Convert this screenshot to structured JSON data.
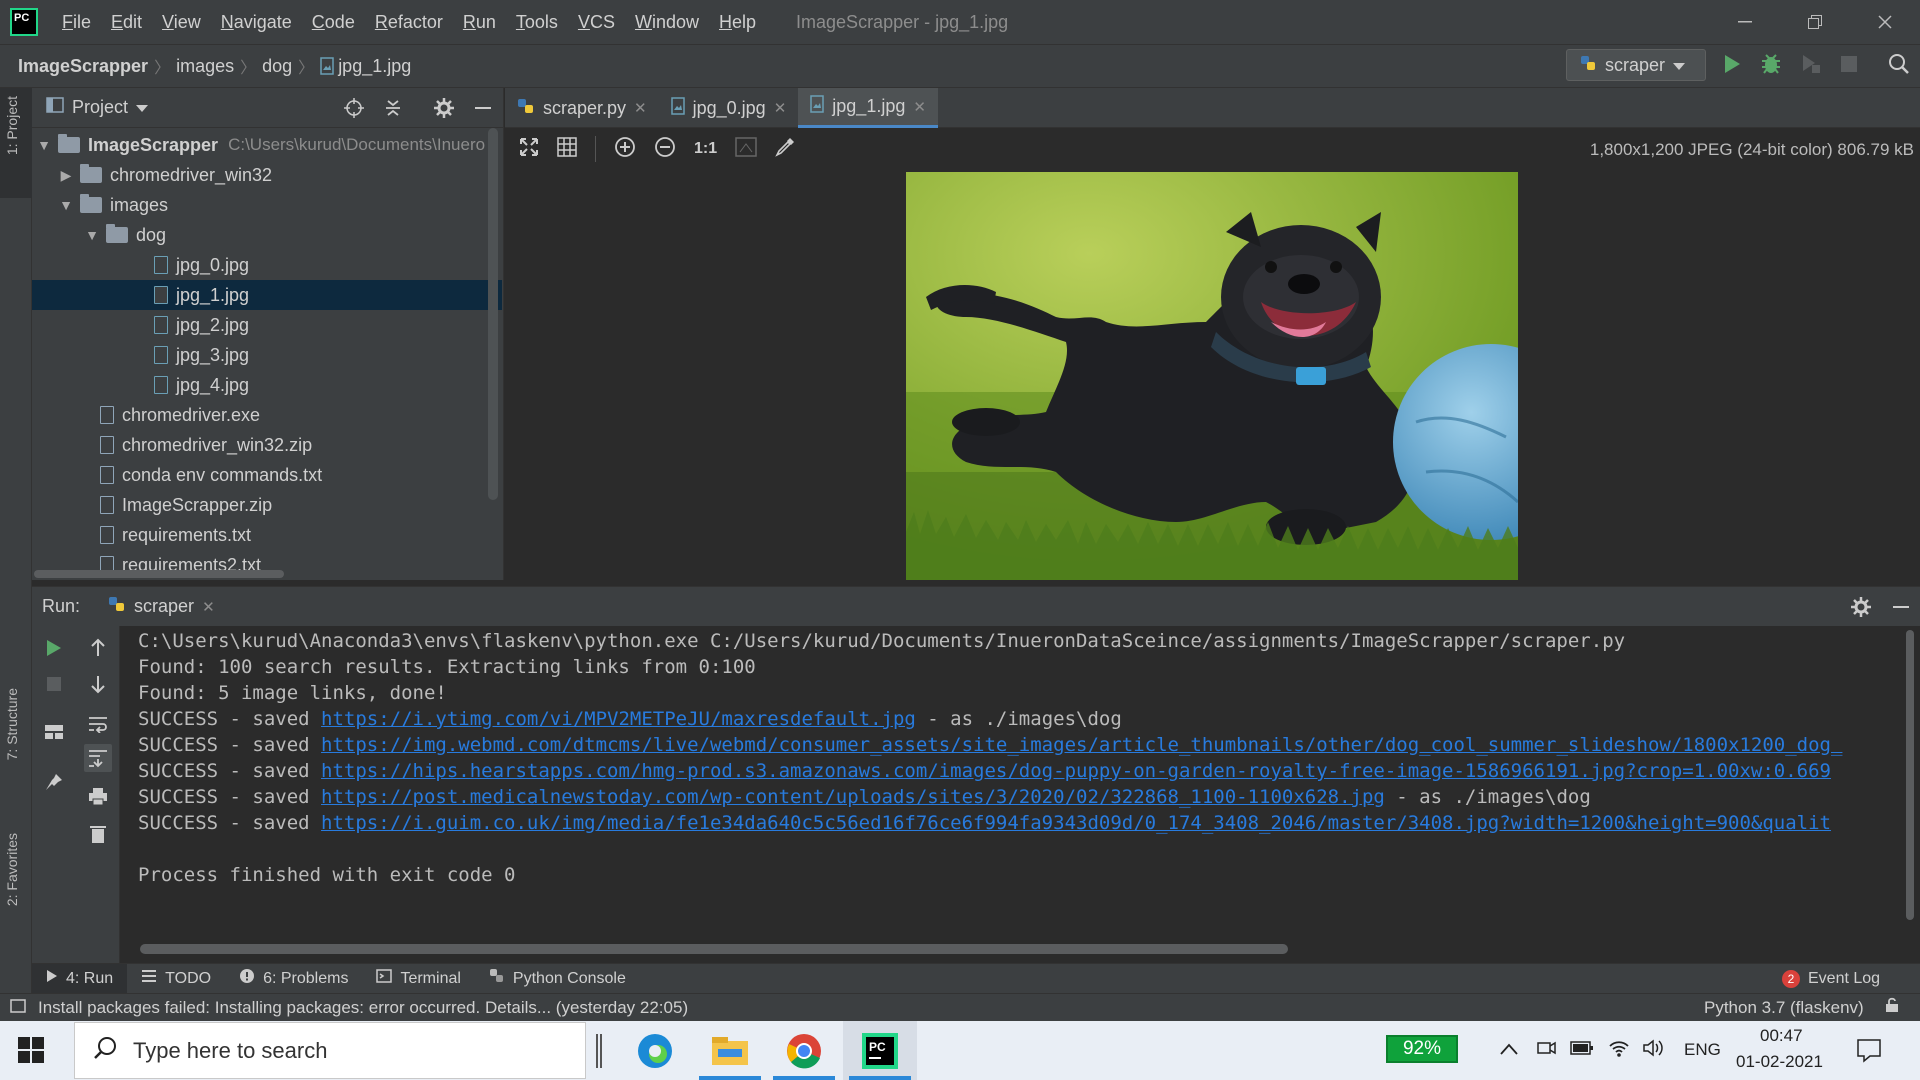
{
  "titlebar": {
    "menu": [
      "File",
      "Edit",
      "View",
      "Navigate",
      "Code",
      "Refactor",
      "Run",
      "Tools",
      "VCS",
      "Window",
      "Help"
    ],
    "window_title": "ImageScrapper - jpg_1.jpg"
  },
  "breadcrumb": [
    "ImageScrapper",
    "images",
    "dog",
    "jpg_1.jpg"
  ],
  "run_config": {
    "label": "scraper"
  },
  "left_stripe": {
    "project": "1: Project",
    "structure": "7: Structure",
    "favorites": "2: Favorites"
  },
  "project_panel": {
    "title": "Project",
    "root_name": "ImageScrapper",
    "root_path": "C:\\Users\\kurud\\Documents\\Inuero",
    "items": [
      {
        "label": "chromedriver_win32",
        "type": "folder"
      },
      {
        "label": "images",
        "type": "folder"
      },
      {
        "label": "dog",
        "type": "folder"
      },
      {
        "label": "jpg_0.jpg",
        "type": "image"
      },
      {
        "label": "jpg_1.jpg",
        "type": "image"
      },
      {
        "label": "jpg_2.jpg",
        "type": "image"
      },
      {
        "label": "jpg_3.jpg",
        "type": "image"
      },
      {
        "label": "jpg_4.jpg",
        "type": "image"
      },
      {
        "label": "chromedriver.exe",
        "type": "file"
      },
      {
        "label": "chromedriver_win32.zip",
        "type": "file"
      },
      {
        "label": "conda env commands.txt",
        "type": "file"
      },
      {
        "label": "ImageScrapper.zip",
        "type": "file"
      },
      {
        "label": "requirements.txt",
        "type": "file"
      },
      {
        "label": "requirements2.txt",
        "type": "file"
      }
    ]
  },
  "editor": {
    "tabs": [
      "scraper.py",
      "jpg_0.jpg",
      "jpg_1.jpg"
    ],
    "active_tab": "jpg_1.jpg",
    "image_info": "1,800x1,200 JPEG (24-bit color) 806.79 kB",
    "zoom_1to1": "1:1"
  },
  "run_panel": {
    "label": "Run:",
    "tab": "scraper",
    "lines": [
      "C:\\Users\\kurud\\Anaconda3\\envs\\flaskenv\\python.exe C:/Users/kurud/Documents/InueronDataSceince/assignments/ImageScrapper/scraper.py",
      "Found: 100 search results. Extracting links from 0:100",
      "Found: 5 image links, done!"
    ],
    "success_prefix": "SUCCESS - saved ",
    "success_lines": [
      {
        "url": "https://i.ytimg.com/vi/MPV2METPeJU/maxresdefault.jpg",
        "suffix": " - as ./images\\dog"
      },
      {
        "url": "https://img.webmd.com/dtmcms/live/webmd/consumer_assets/site_images/article_thumbnails/other/dog_cool_summer_slideshow/1800x1200_dog_",
        "suffix": ""
      },
      {
        "url": "https://hips.hearstapps.com/hmg-prod.s3.amazonaws.com/images/dog-puppy-on-garden-royalty-free-image-1586966191.jpg?crop=1.00xw:0.669",
        "suffix": ""
      },
      {
        "url": "https://post.medicalnewstoday.com/wp-content/uploads/sites/3/2020/02/322868_1100-1100x628.jpg",
        "suffix": " - as ./images\\dog"
      },
      {
        "url": "https://i.guim.co.uk/img/media/fe1e34da640c5c56ed16f76ce6f994fa9343d09d/0_174_3408_2046/master/3408.jpg?width=1200&height=900&qualit",
        "suffix": ""
      }
    ],
    "exit_line": "Process finished with exit code 0"
  },
  "bottom_tools": {
    "run": "4: Run",
    "todo": "TODO",
    "problems": "6: Problems",
    "terminal": "Terminal",
    "python_console": "Python Console",
    "event_log": "Event Log",
    "event_count": "2"
  },
  "statusbar": {
    "message": "Install packages failed: Installing packages: error occurred. Details... (yesterday 22:05)",
    "interpreter": "Python 3.7 (flaskenv)"
  },
  "taskbar": {
    "search_placeholder": "Type here to search",
    "battery": "92%",
    "language": "ENG",
    "time": "00:47",
    "date": "01-02-2021"
  }
}
